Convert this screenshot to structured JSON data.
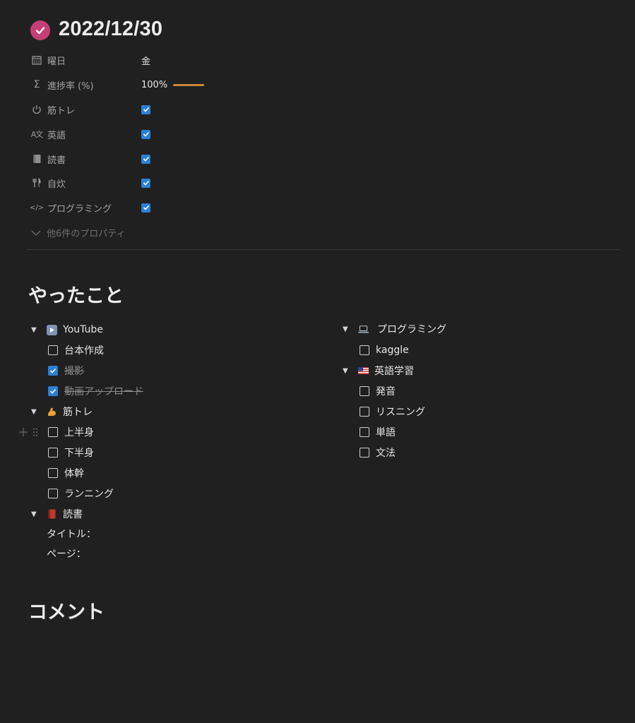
{
  "page": {
    "title": "2022/12/30"
  },
  "properties": [
    {
      "label": "曜日",
      "icon": "calendar-icon",
      "value": "金"
    },
    {
      "label": "進捗率 (%)",
      "icon": "sigma-icon",
      "value": "100%",
      "progress": 1.0
    },
    {
      "label": "筋トレ",
      "icon": "power-icon",
      "checked": true
    },
    {
      "label": "英語",
      "icon": "translate-icon",
      "checked": true
    },
    {
      "label": "読書",
      "icon": "book-icon",
      "checked": true
    },
    {
      "label": "自炊",
      "icon": "fork-knife-icon",
      "checked": true
    },
    {
      "label": "プログラミング",
      "icon": "code-icon",
      "checked": true
    }
  ],
  "more_properties": "他6件のプロパティ",
  "sections": {
    "done": "やったこと",
    "comment": "コメント"
  },
  "left_column": {
    "youtube": {
      "label": "YouTube",
      "icon": "play-button-icon",
      "items": [
        {
          "label": "台本作成",
          "checked": false
        },
        {
          "label": "撮影",
          "checked": true
        },
        {
          "label": "動画アップロード",
          "checked": true
        }
      ]
    },
    "workout": {
      "label": "筋トレ",
      "icon": "flexed-biceps-icon",
      "items": [
        {
          "label": "上半身",
          "checked": false
        },
        {
          "label": "下半身",
          "checked": false
        },
        {
          "label": "体幹",
          "checked": false
        },
        {
          "label": "ランニング",
          "checked": false
        }
      ]
    },
    "reading": {
      "label": "読書",
      "icon": "red-book-icon",
      "lines": [
        "タイトル：",
        "ページ："
      ]
    }
  },
  "right_column": {
    "programming": {
      "label": "プログラミング",
      "icon": "laptop-icon",
      "items": [
        {
          "label": "kaggle",
          "checked": false
        }
      ]
    },
    "english": {
      "label": "英語学習",
      "icon": "us-flag-icon",
      "items": [
        {
          "label": "発音",
          "checked": false
        },
        {
          "label": "リスニング",
          "checked": false
        },
        {
          "label": "単語",
          "checked": false
        },
        {
          "label": "文法",
          "checked": false
        }
      ]
    }
  },
  "colors": {
    "background": "#202020",
    "accent_pink": "#c63e77",
    "checkbox_blue": "#2d7fd6",
    "progress": "#c8883b"
  }
}
